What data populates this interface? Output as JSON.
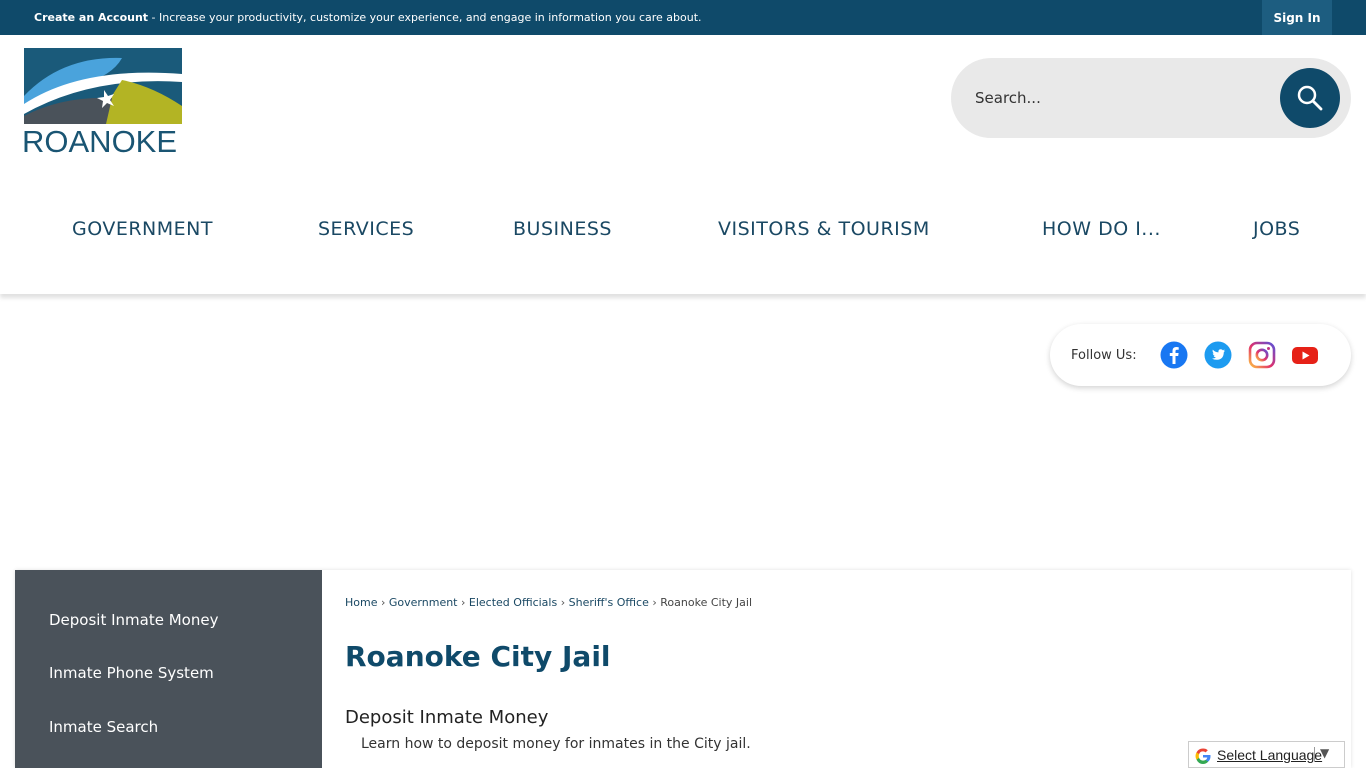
{
  "topbar": {
    "create_account": "Create an Account",
    "message": " - Increase your productivity, customize your experience, and engage in information you care about.",
    "sign_in": "Sign In"
  },
  "logo": {
    "text": "ROANOKE"
  },
  "search": {
    "placeholder": "Search...",
    "icon": "search-icon"
  },
  "nav": {
    "items": [
      "GOVERNMENT",
      "SERVICES",
      "BUSINESS",
      "VISITORS & TOURISM",
      "HOW DO I...",
      "JOBS"
    ]
  },
  "follow": {
    "label": "Follow Us:",
    "icons": [
      "facebook-icon",
      "twitter-icon",
      "instagram-icon",
      "youtube-icon"
    ]
  },
  "sidebar": {
    "items": [
      "Deposit Inmate Money",
      "Inmate Phone System",
      "Inmate Search"
    ]
  },
  "breadcrumb": {
    "items": [
      "Home",
      "Government",
      "Elected Officials",
      "Sheriff's Office"
    ],
    "current": "Roanoke City Jail",
    "separator": "›"
  },
  "main": {
    "title": "Roanoke City Jail",
    "section_title": "Deposit Inmate Money",
    "section_desc": "Learn how to deposit money for inmates in the City jail."
  },
  "language": {
    "label": "Select Language",
    "arrow": "▼"
  },
  "colors": {
    "brand": "#0f4a6a",
    "sidebar": "#4a525a",
    "nav_text": "#1a4863"
  }
}
